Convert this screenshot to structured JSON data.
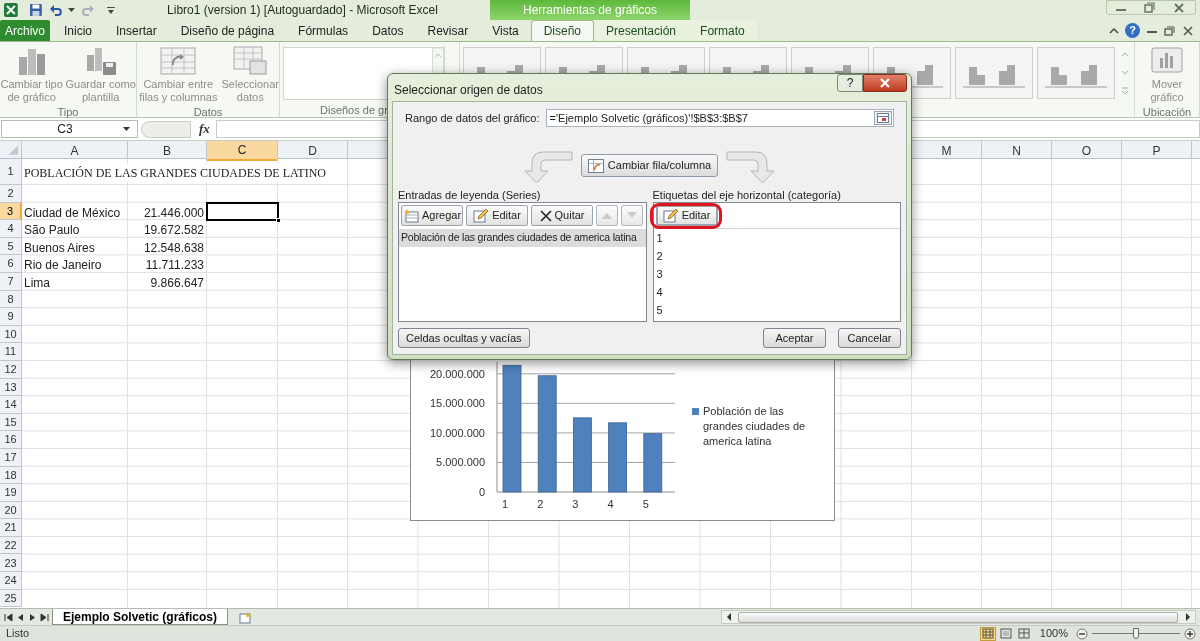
{
  "title_bar": {
    "title": "Libro1 (version 1) [Autoguardado]  -  Microsoft Excel",
    "contextual_group": "Herramientas de gráficos"
  },
  "ribbon_tabs": [
    {
      "label": "Archivo",
      "kind": "file",
      "selected": false
    },
    {
      "label": "Inicio",
      "kind": "normal",
      "selected": false
    },
    {
      "label": "Insertar",
      "kind": "normal",
      "selected": false
    },
    {
      "label": "Diseño de página",
      "kind": "normal",
      "selected": false
    },
    {
      "label": "Fórmulas",
      "kind": "normal",
      "selected": false
    },
    {
      "label": "Datos",
      "kind": "normal",
      "selected": false
    },
    {
      "label": "Revisar",
      "kind": "normal",
      "selected": false
    },
    {
      "label": "Vista",
      "kind": "normal",
      "selected": false
    },
    {
      "label": "Diseño",
      "kind": "contextual",
      "selected": true
    },
    {
      "label": "Presentación",
      "kind": "contextual",
      "selected": false
    },
    {
      "label": "Formato",
      "kind": "contextual",
      "selected": false
    }
  ],
  "ribbon_help": "?",
  "ribbon_groups": [
    {
      "kind": "buttons",
      "label": "Tipo",
      "buttons": [
        "Cambiar tipo de gráfico",
        "Guardar como plantilla"
      ]
    },
    {
      "kind": "buttons",
      "label": "Datos",
      "buttons": [
        "Cambiar entre filas y columnas",
        "Seleccionar datos"
      ]
    },
    {
      "kind": "gallery",
      "label": "Diseños de gr"
    },
    {
      "kind": "styles"
    },
    {
      "kind": "buttons",
      "label": "Ubicación",
      "buttons": [
        "Mover gráfico"
      ]
    }
  ],
  "formula_bar": {
    "name_box": "C3",
    "function_label": "fx"
  },
  "sheet": {
    "columns": [
      {
        "label": "A",
        "selected": false
      },
      {
        "label": "B",
        "selected": false
      },
      {
        "label": "C",
        "selected": true
      },
      {
        "label": "D",
        "selected": false
      },
      {
        "label": "M",
        "selected": false
      },
      {
        "label": "N",
        "selected": false
      },
      {
        "label": "O",
        "selected": false
      },
      {
        "label": "P",
        "selected": false
      }
    ],
    "rows": [
      {
        "header": "1",
        "kind": "title",
        "selected": false,
        "cells": {
          "A": "POBLACIÓN DE LAS GRANDES CIUDADES DE LATINO"
        }
      },
      {
        "header": "2",
        "kind": "blank",
        "selected": false
      },
      {
        "header": "3",
        "kind": "data",
        "selected": true,
        "cells": {
          "A": "Ciudad de México",
          "B": "21.446.000"
        }
      },
      {
        "header": "4",
        "kind": "data",
        "selected": false,
        "cells": {
          "A": "São Paulo",
          "B": "19.672.582"
        }
      },
      {
        "header": "5",
        "kind": "data",
        "selected": false,
        "cells": {
          "A": "Buenos Aires",
          "B": "12.548.638"
        }
      },
      {
        "header": "6",
        "kind": "data",
        "selected": false,
        "cells": {
          "A": "Rio de Janeiro",
          "B": "11.711.233"
        }
      },
      {
        "header": "7",
        "kind": "data",
        "selected": false,
        "cells": {
          "A": "Lima",
          "B": "9.866.647"
        }
      },
      {
        "header": "8",
        "kind": "blank",
        "selected": false
      },
      {
        "header": "9",
        "kind": "blank",
        "selected": false
      },
      {
        "header": "10",
        "kind": "blank",
        "selected": false
      },
      {
        "header": "11",
        "kind": "blank",
        "selected": false
      },
      {
        "header": "12",
        "kind": "blank",
        "selected": false
      },
      {
        "header": "13",
        "kind": "blank",
        "selected": false
      },
      {
        "header": "14",
        "kind": "blank",
        "selected": false
      },
      {
        "header": "15",
        "kind": "blank",
        "selected": false
      },
      {
        "header": "16",
        "kind": "blank",
        "selected": false
      },
      {
        "header": "17",
        "kind": "blank",
        "selected": false
      },
      {
        "header": "18",
        "kind": "blank",
        "selected": false
      },
      {
        "header": "19",
        "kind": "blank",
        "selected": false
      },
      {
        "header": "20",
        "kind": "blank",
        "selected": false
      },
      {
        "header": "21",
        "kind": "blank",
        "selected": false
      },
      {
        "header": "22",
        "kind": "blank",
        "selected": false
      },
      {
        "header": "23",
        "kind": "blank",
        "selected": false
      },
      {
        "header": "24",
        "kind": "blank",
        "selected": false
      },
      {
        "header": "25",
        "kind": "blank",
        "selected": false
      }
    ]
  },
  "chart": {
    "chart_data": {
      "type": "bar",
      "grid": true,
      "ylim": [
        0,
        22000000
      ],
      "categories": [
        "1",
        "2",
        "3",
        "4",
        "5"
      ],
      "series": [
        {
          "name": "Población de las grandes ciudades de america latina",
          "color": "#4f81bd",
          "values": [
            21446000,
            19672582,
            12548638,
            11711233,
            9866647
          ]
        }
      ],
      "yticks": [
        {
          "value": 0,
          "label": "0"
        },
        {
          "value": 5000000,
          "label": "5.000.000"
        },
        {
          "value": 10000000,
          "label": "10.000.000"
        },
        {
          "value": 15000000,
          "label": "15.000.000"
        },
        {
          "value": 20000000,
          "label": "20.000.000"
        }
      ]
    }
  },
  "dialog": {
    "title": "Seleccionar origen de datos",
    "help_button": "?",
    "range_label": "Rango de datos del gráfico:",
    "range_value": "='Ejemplo Solvetic (gráficos)'!$B$3:$B$7",
    "switch_button": "Cambiar fila/columna",
    "series_panel": {
      "label": "Entradas de leyenda (Series)",
      "buttons": [
        {
          "kind": "add",
          "label": "Agregar",
          "disabled": false
        },
        {
          "kind": "edit",
          "label": "Editar",
          "disabled": false
        },
        {
          "kind": "remove",
          "label": "Quitar",
          "disabled": false
        },
        {
          "kind": "up",
          "disabled": true
        },
        {
          "kind": "down",
          "disabled": true
        }
      ],
      "items": [
        {
          "label": "Población de las grandes ciudades de america latina",
          "selected": true
        }
      ]
    },
    "category_panel": {
      "label": "Etiquetas del eje horizontal (categoría)",
      "edit_button": {
        "label": "Editar",
        "focused": true,
        "highlighted": true
      },
      "items": [
        "1",
        "2",
        "3",
        "4",
        "5"
      ]
    },
    "hidden_cells_button": "Celdas ocultas y vacías",
    "ok_button": "Aceptar",
    "cancel_button": "Cancelar"
  },
  "sheet_tabs": [
    {
      "label": "Ejemplo Solvetic (gráficos)",
      "selected": true
    }
  ],
  "status_bar": {
    "status": "Listo",
    "views": [
      {
        "kind": "normal",
        "selected": true
      },
      {
        "kind": "page_layout",
        "selected": false
      },
      {
        "kind": "page_break",
        "selected": false
      }
    ],
    "zoom_label": "100%",
    "zoom": {
      "level": 0.5
    }
  }
}
